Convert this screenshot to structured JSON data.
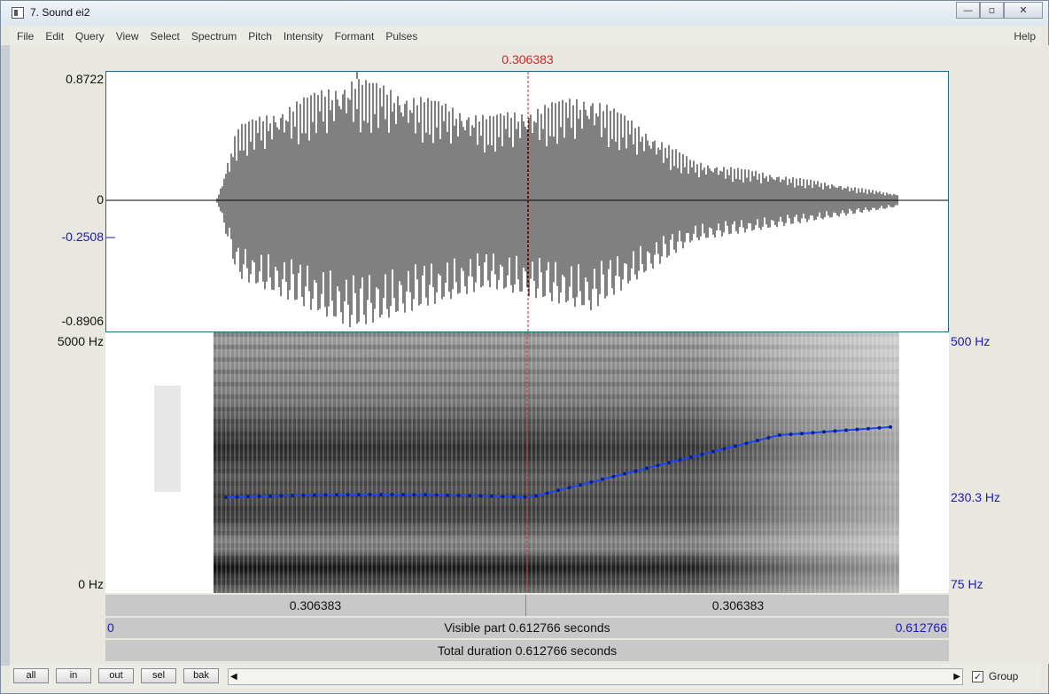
{
  "window": {
    "title": "7. Sound ei2"
  },
  "title_buttons": {
    "minimize": "—",
    "maximize": "▫",
    "close": "✕"
  },
  "menu": [
    "File",
    "Edit",
    "Query",
    "View",
    "Select",
    "Spectrum",
    "Pitch",
    "Intensity",
    "Formant",
    "Pulses"
  ],
  "help": "Help",
  "cursor": {
    "time": "0.306383"
  },
  "waveform": {
    "ymax": "0.8722",
    "zero": "0",
    "cursor_value": "-0.2508",
    "ymin": "-0.8906"
  },
  "spectrogram": {
    "top": "5000 Hz",
    "bottom": "0 Hz",
    "pitch_top": "500 Hz",
    "pitch_value": "230.3 Hz",
    "pitch_bottom": "75 Hz"
  },
  "selection_row": {
    "left": "0.306383",
    "right": "0.306383"
  },
  "visible_row": {
    "start": "0",
    "label": "Visible part 0.612766 seconds",
    "end": "0.612766"
  },
  "total_row": {
    "label": "Total duration 0.612766 seconds"
  },
  "bottom_buttons": {
    "all": "all",
    "in": "in",
    "out": "out",
    "sel": "sel",
    "bak": "bak"
  },
  "scroll": {
    "left_arrow": "◀",
    "right_arrow": "▶"
  },
  "group": {
    "label": "Group",
    "checked": "✓"
  },
  "colors": {
    "cursor": "#d22222",
    "pitch_line": "#1a46ff",
    "axis_blue": "#1a1ab8",
    "frame": "#1a6c8a"
  }
}
